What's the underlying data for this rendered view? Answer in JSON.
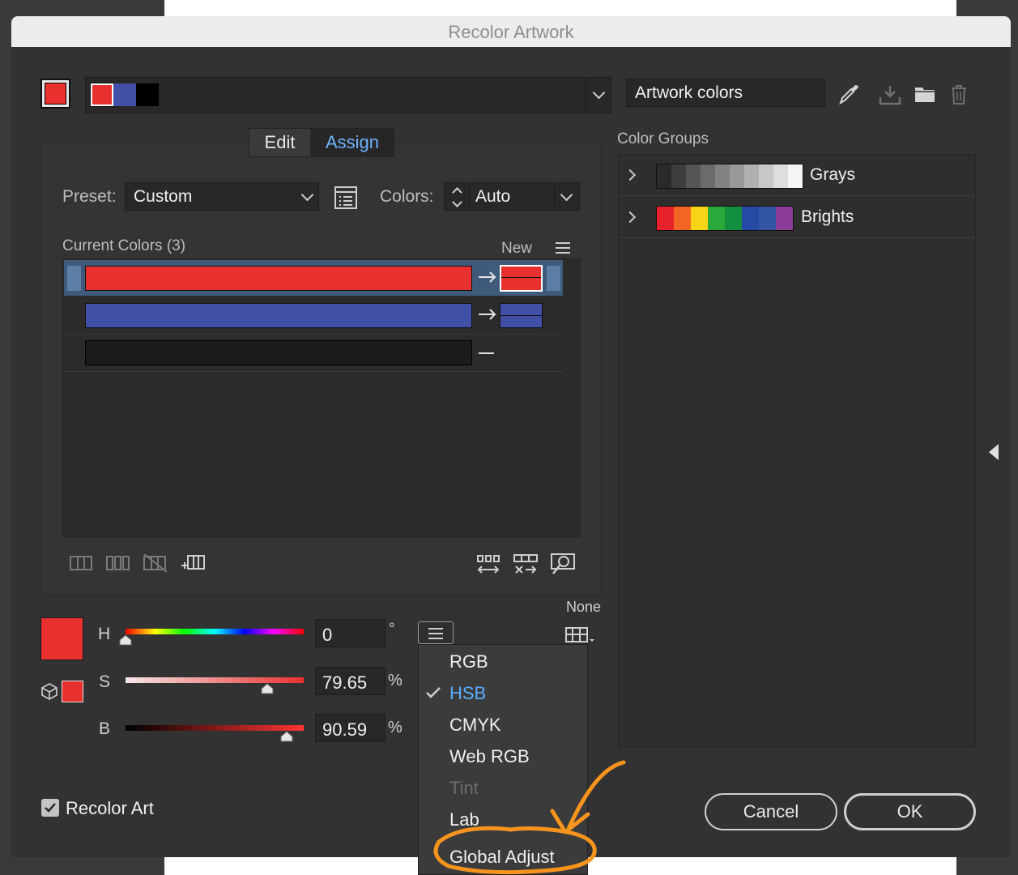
{
  "window": {
    "title": "Recolor Artwork"
  },
  "top_bar": {
    "swatches": [
      "#e8312f",
      "#4150a6",
      "#000000"
    ],
    "source": "Artwork colors"
  },
  "tabs": [
    {
      "label": "Edit"
    },
    {
      "label": "Assign"
    }
  ],
  "assign": {
    "preset_label": "Preset:",
    "preset_value": "Custom",
    "colors_label": "Colors:",
    "colors_value": "Auto",
    "current_colors_label": "Current Colors (3)",
    "new_label": "New",
    "rows": [
      {
        "current": "#e8312f",
        "new": "#e8312f",
        "selected": true,
        "mapped": true
      },
      {
        "current": "#4150a6",
        "new": "#4150a6",
        "selected": false,
        "mapped": true
      },
      {
        "current": "#1c1a1b",
        "new": "",
        "selected": false,
        "mapped": false
      }
    ]
  },
  "color_groups": {
    "title": "Color Groups",
    "groups": [
      {
        "name": "Grays",
        "swatches": [
          "#2a2a2a",
          "#3d3d3d",
          "#555555",
          "#6b6b6b",
          "#828282",
          "#999999",
          "#b0b0b0",
          "#c8c8c8",
          "#dedede",
          "#f5f5f5"
        ]
      },
      {
        "name": "Brights",
        "swatches": [
          "#e8222a",
          "#f26522",
          "#f7d417",
          "#2aa839",
          "#12903f",
          "#244aa5",
          "#3454a4",
          "#8b3d99"
        ]
      }
    ]
  },
  "sliders": {
    "h": {
      "label": "H",
      "value": "0",
      "unit": "°",
      "fraction": 0.0
    },
    "s": {
      "label": "S",
      "value": "79.65",
      "unit": "%",
      "fraction": 0.7965
    },
    "b": {
      "label": "B",
      "value": "90.59",
      "unit": "%",
      "fraction": 0.9059
    },
    "current_color": "#e8312f",
    "none_label": "None"
  },
  "color_mode_menu": {
    "items": [
      {
        "label": "RGB",
        "checked": false,
        "disabled": false
      },
      {
        "label": "HSB",
        "checked": true,
        "disabled": false
      },
      {
        "label": "CMYK",
        "checked": false,
        "disabled": false
      },
      {
        "label": "Web RGB",
        "checked": false,
        "disabled": false
      },
      {
        "label": "Tint",
        "checked": false,
        "disabled": true
      },
      {
        "label": "Lab",
        "checked": false,
        "disabled": false
      },
      {
        "label": "Global Adjust",
        "checked": false,
        "disabled": false
      }
    ]
  },
  "footer": {
    "recolor_art_label": "Recolor Art",
    "recolor_art_checked": true,
    "cancel_label": "Cancel",
    "ok_label": "OK"
  },
  "annotation": {
    "color": "#f7941d"
  }
}
